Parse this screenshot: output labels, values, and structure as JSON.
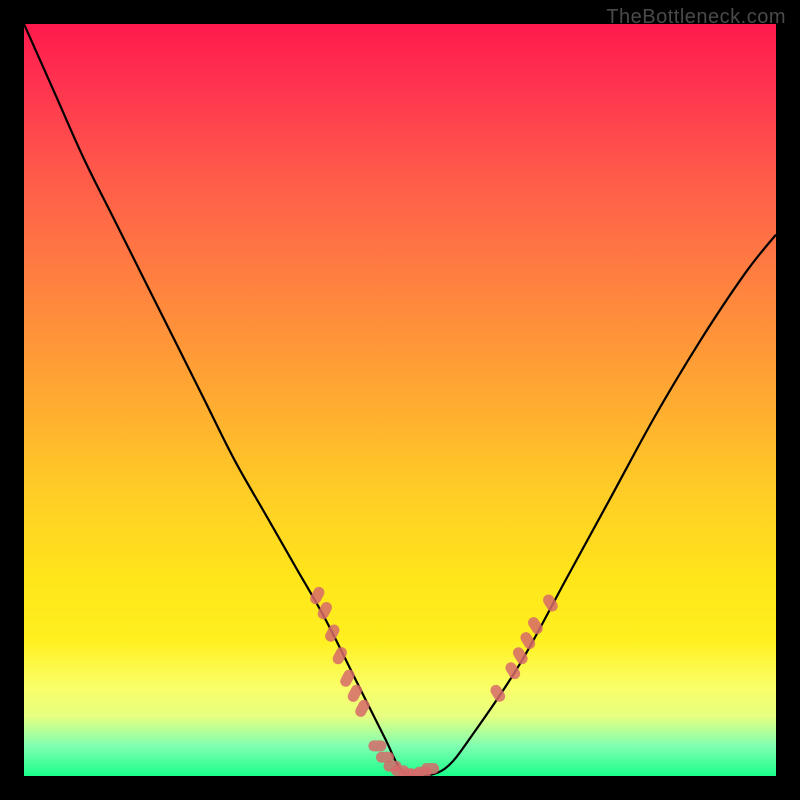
{
  "watermark": "TheBottleneck.com",
  "chart_data": {
    "type": "line",
    "title": "",
    "xlabel": "",
    "ylabel": "",
    "xlim": [
      0,
      100
    ],
    "ylim": [
      0,
      100
    ],
    "series": [
      {
        "name": "curve",
        "x": [
          0,
          4,
          8,
          12,
          16,
          20,
          24,
          28,
          32,
          36,
          40,
          44,
          48,
          50,
          52,
          56,
          60,
          66,
          72,
          78,
          84,
          90,
          96,
          100
        ],
        "y": [
          100,
          91,
          82,
          74,
          66,
          58,
          50,
          42,
          35,
          28,
          21,
          13,
          5,
          1,
          0,
          1,
          6,
          15,
          26,
          37,
          48,
          58,
          67,
          72
        ]
      }
    ],
    "markers_left": [
      {
        "x": 39,
        "y": 24
      },
      {
        "x": 40,
        "y": 22
      },
      {
        "x": 41,
        "y": 19
      },
      {
        "x": 42,
        "y": 16
      },
      {
        "x": 43,
        "y": 13
      },
      {
        "x": 44,
        "y": 11
      },
      {
        "x": 45,
        "y": 9
      }
    ],
    "markers_bottom": [
      {
        "x": 47,
        "y": 4
      },
      {
        "x": 48,
        "y": 2.5
      },
      {
        "x": 49,
        "y": 1.3
      },
      {
        "x": 50,
        "y": 0.7
      },
      {
        "x": 51,
        "y": 0.3
      },
      {
        "x": 52,
        "y": 0.2
      },
      {
        "x": 53,
        "y": 0.5
      },
      {
        "x": 54,
        "y": 1
      }
    ],
    "markers_right": [
      {
        "x": 63,
        "y": 11
      },
      {
        "x": 65,
        "y": 14
      },
      {
        "x": 66,
        "y": 16
      },
      {
        "x": 67,
        "y": 18
      },
      {
        "x": 68,
        "y": 20
      },
      {
        "x": 70,
        "y": 23
      }
    ],
    "gradient_stops": [
      {
        "pct": 0,
        "color": "#ff1a4d"
      },
      {
        "pct": 20,
        "color": "#ff5a4a"
      },
      {
        "pct": 48,
        "color": "#ffa533"
      },
      {
        "pct": 74,
        "color": "#ffe61a"
      },
      {
        "pct": 92,
        "color": "#e8ff80"
      },
      {
        "pct": 100,
        "color": "#1aff8c"
      }
    ]
  }
}
